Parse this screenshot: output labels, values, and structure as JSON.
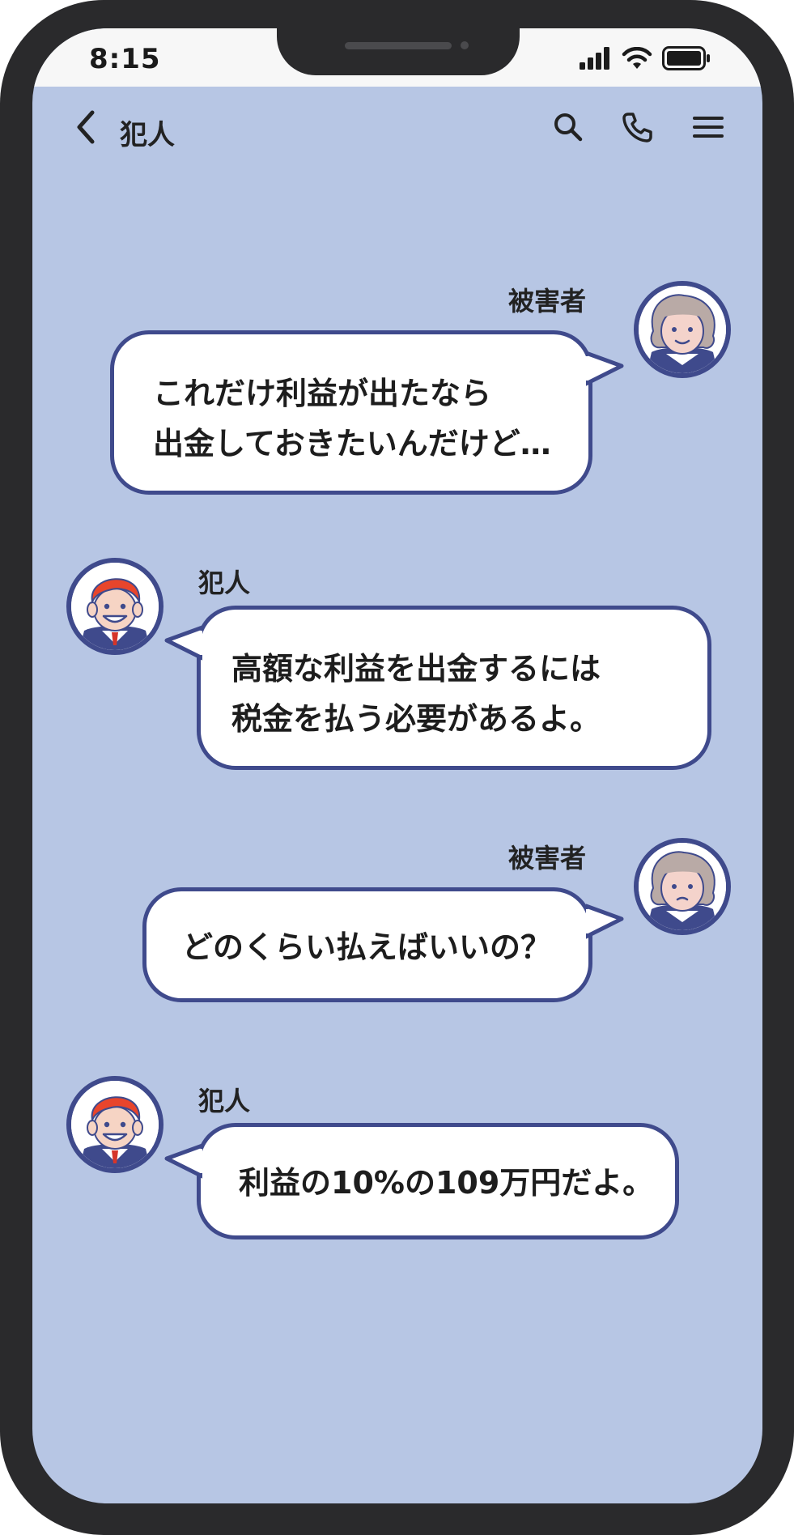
{
  "status_bar": {
    "time": "8:15",
    "icons": [
      "signal-icon",
      "wifi-icon",
      "battery-icon"
    ]
  },
  "header": {
    "back_icon": "chevron-left-icon",
    "title": "犯人",
    "actions": [
      "search-icon",
      "phone-icon",
      "menu-icon"
    ]
  },
  "messages": [
    {
      "side": "right",
      "sender": "被害者",
      "lines": [
        "これだけ利益が出たなら",
        "出金しておきたいんだけど…"
      ]
    },
    {
      "side": "left",
      "sender": "犯人",
      "lines": [
        "高額な利益を出金するには",
        "税金を払う必要があるよ。"
      ]
    },
    {
      "side": "right",
      "sender": "被害者",
      "lines": [
        "どのくらい払えばいいの？"
      ]
    },
    {
      "side": "left",
      "sender": "犯人",
      "lines": [
        "利益の10%の109万円だよ。"
      ]
    }
  ],
  "colors": {
    "chat_background": "#b7c6e4",
    "bubble_border": "#3f4a8c",
    "bubble_fill": "#ffffff",
    "frame": "#2a2a2c"
  }
}
